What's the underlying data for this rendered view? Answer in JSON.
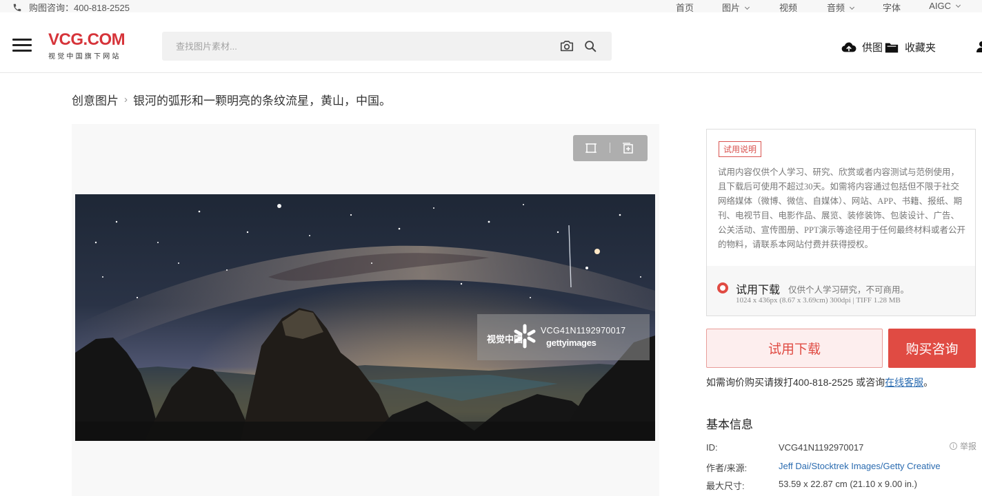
{
  "utility_bar": {
    "phone_label": "购图咨询：400-818-2525",
    "nav": [
      "首页",
      "图片",
      "视频",
      "音频",
      "字体",
      "AIGC"
    ]
  },
  "header": {
    "logo_main": "VCG.COM",
    "logo_sub": "视觉中国旗下网站",
    "search_placeholder": "查找图片素材...",
    "supply_label": "供图",
    "favorites_label": "收藏夹"
  },
  "breadcrumb": {
    "root": "创意图片",
    "current": "银河的弧形和一颗明亮的条纹流星，黄山，中国。"
  },
  "watermark": {
    "brand": "视觉中国",
    "id": "VCG41N1192970017",
    "getty": "gettyimages"
  },
  "trial": {
    "tag": "试用说明",
    "description": "试用内容仅供个人学习、研究、欣赏或者内容测试与范例使用，且下载后可使用不超过30天。如需将内容通过包括但不限于社交网络媒体（微博、微信、自媒体）、网站、APP、书籍、报纸、期刊、电视节目、电影作品、展览、装修装饰、包装设计、广告、公关活动、宣传图册、PPT演示等途径用于任何最终材料或者公开的物料，请联系本网站付费并获得授权。",
    "option_name": "试用下载",
    "option_note": "仅供个人学习研究，不可商用。",
    "option_spec": "1024 x 436px (8.67 x 3.69cm) 300dpi | TIFF 1.28 MB"
  },
  "actions": {
    "trial_download": "试用下载",
    "buy_consult": "购买咨询"
  },
  "consult": {
    "text": "如需询价购买请拨打400-818-2525 或咨询",
    "link": "在线客服",
    "end": "。"
  },
  "info": {
    "title": "基本信息",
    "report": "举报",
    "rows": [
      {
        "key": "ID:",
        "value": "VCG41N1192970017"
      },
      {
        "key": "作者/来源:",
        "value": "Jeff Dai/Stocktrek Images/Getty Creative"
      },
      {
        "key": "最大尺寸:",
        "value": "53.59 x 22.87 cm (21.10 x 9.00 in.)"
      }
    ]
  },
  "colors": {
    "brand_red": "#d6343a",
    "accent_red": "#e04b43",
    "link_blue": "#2a6bb0"
  }
}
